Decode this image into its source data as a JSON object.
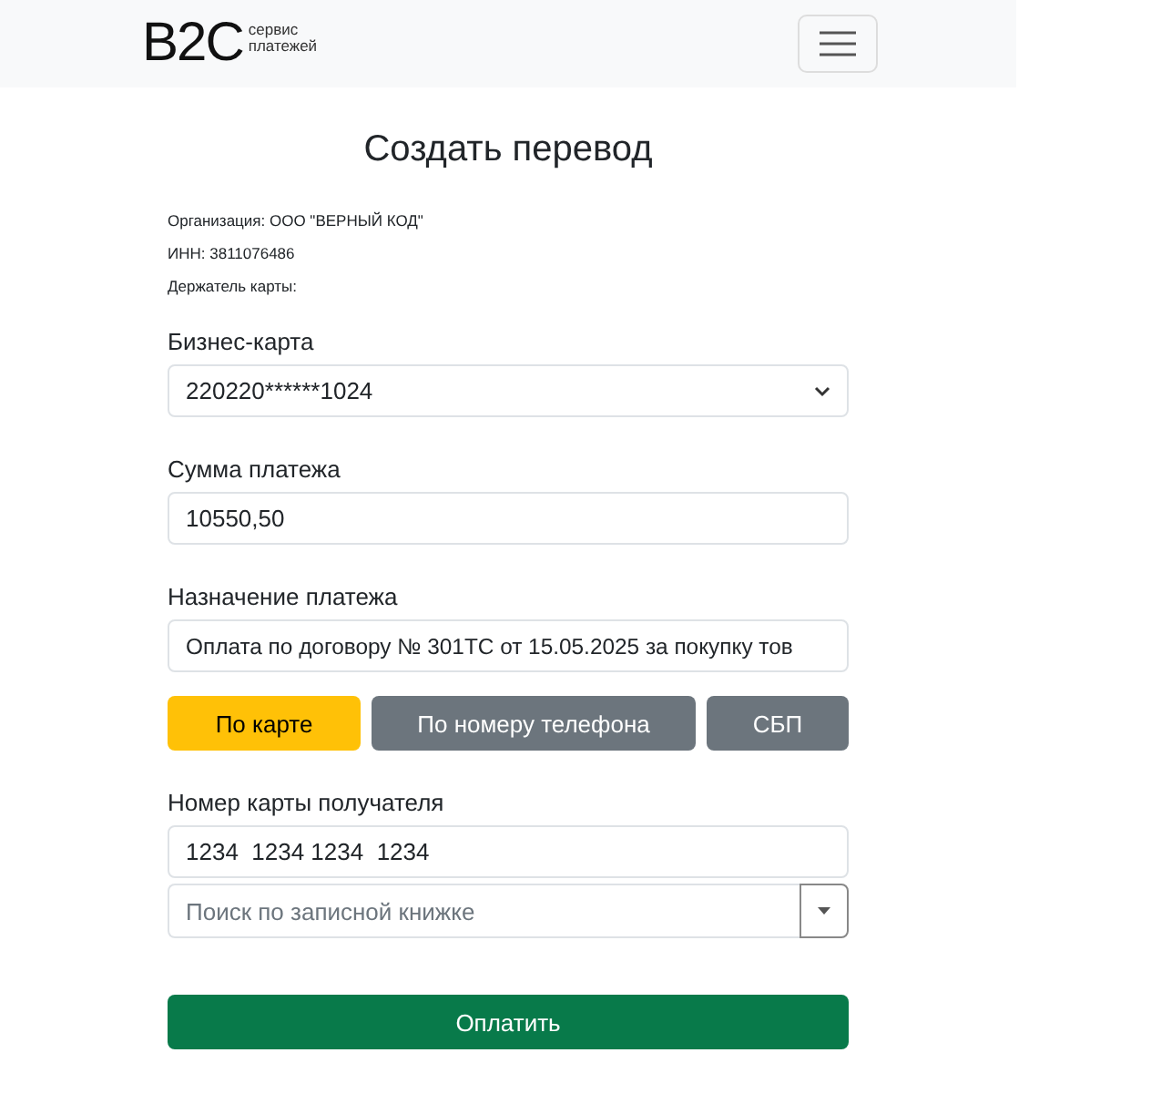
{
  "header": {
    "logo": "B2C",
    "logo_tagline": "сервис платежей"
  },
  "title": "Создать перевод",
  "info": [
    {
      "label": "Организация:",
      "value": "ООО \"ВЕРНЫЙ КОД\""
    },
    {
      "label": "ИНН:",
      "value": "3811076486"
    },
    {
      "label": "Держатель карты:"
    }
  ],
  "fields": [
    {
      "kind": "select",
      "label": "Бизнес-карта",
      "value": "220220******1024"
    },
    {
      "kind": "text",
      "label": "Сумма платежа",
      "value": "10550,50"
    },
    {
      "kind": "text",
      "label": "Назначение платежа",
      "value": "Оплата по договору № 301ТС от 15.05.2025 за покупку тов"
    }
  ],
  "methods": [
    {
      "label": "По карте",
      "selected": true
    },
    {
      "label": "По номеру телефона",
      "selected": false
    },
    {
      "label": "СБП",
      "selected": false
    }
  ],
  "recipient": {
    "label": "Номер карты получателя",
    "value": "1234  1234 1234  1234",
    "search_placeholder": "Поиск по записной книжке"
  },
  "pay_button": "Оплатить"
}
